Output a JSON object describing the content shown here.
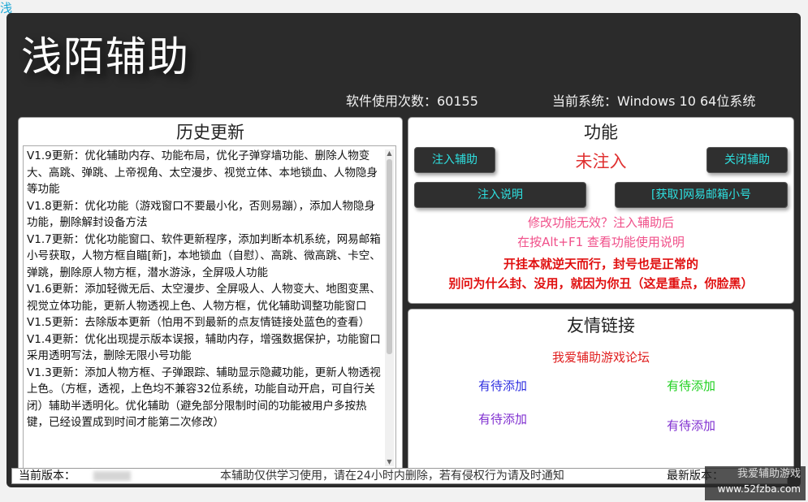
{
  "corner_char": "浅",
  "app_title": "浅陌辅助",
  "usage_text": "软件使用次数：60155",
  "system_text": "当前系统：Windows 10   64位系统",
  "history": {
    "title": "历史更新",
    "entries": [
      "V1.9更新：优化辅助内存、功能布局，优化子弹穿墙功能、删除人物变大、高跳、弹跳、上帝视角、太空漫步、视觉立体、本地锁血、人物隐身等功能",
      "V1.8更新：优化功能（游戏窗口不要最小化，否则易蹦），添加人物隐身功能，删除解封设备方法",
      "V1.7更新：优化功能窗口、软件更新程序，添加判断本机系统，网易邮箱小号获取，人物方框自瞄[新]，本地锁血（自慰）、高跳、微高跳、卡空、弹跳，删除原人物方框，潜水游泳，全屏吸人功能",
      "V1.6更新：添加轻微无后、太空漫步、全屏吸人、人物变大、地图变黑、视觉立体功能，更新人物透视上色、人物方框，优化辅助调整功能窗口",
      "V1.5更新：去除版本更新（怕用不到最新的点友情链接处蓝色的查看）",
      "V1.4更新：优化出现提示版本误报，辅助内存，增强数据保护，功能窗口采用透明写法，删除无限小号功能",
      "V1.3更新：添加人物方框、子弹跟踪、辅助显示隐藏功能，更新人物透视上色。（方框，透视，上色均不兼容32位系统，功能自动开启，可自行关闭）辅助半透明化。优化辅助（避免部分限制时间的功能被用户多按热键，已经设置成到时间才能第二次修改）"
    ]
  },
  "functions": {
    "title": "功能",
    "inject_button": "注入辅助",
    "status": "未注入",
    "close_button": "关闭辅助",
    "inject_help_button": "注入说明",
    "get_mail_button": "[获取]网易邮箱小号",
    "hint_line1": "修改功能无效？注入辅助后",
    "hint_line2": "在按Alt+F1 查看功能使用说明",
    "warn_line1": "开挂本就逆天而行，封号也是正常的",
    "warn_line2": "别问为什么封、没用，就因为你丑（这是重点，你脸黑）"
  },
  "links": {
    "title": "友情链接",
    "forum_link": "我爱辅助游戏论坛",
    "link1": "有待添加",
    "link2": "有待添加",
    "link3": "有待添加",
    "link4": "有待添加"
  },
  "footer": {
    "current_version_label": "当前版本：",
    "disclaimer": "本辅助仅供学习使用，请在24小时内删除，若有侵权行为请及时通知",
    "latest_version_label": "最新版本："
  },
  "watermark": {
    "top": "我爱辅助游戏",
    "bottom": "www.52fzba.com"
  },
  "colors": {
    "accent_cyan": "#2ee0e0",
    "status_red": "#e03030",
    "hint_pink": "#f0508a",
    "warn_red": "#e01010",
    "forum_red": "#e02020",
    "link_blue": "#3030e0",
    "link_green": "#20d020",
    "link_purple": "#8030d0"
  }
}
